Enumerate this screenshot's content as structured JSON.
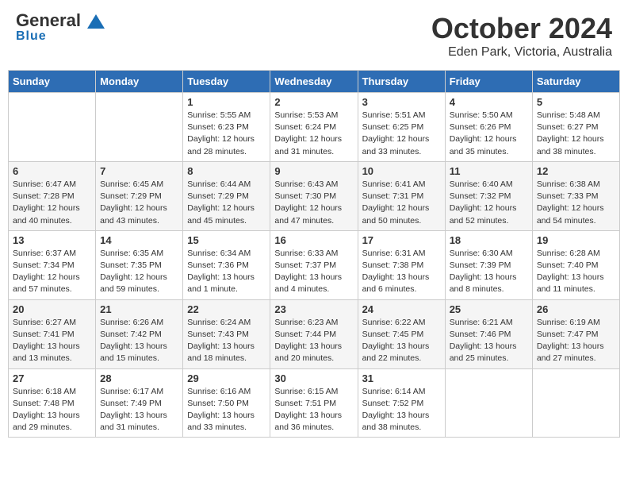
{
  "header": {
    "logo_general": "General",
    "logo_blue": "Blue",
    "month_title": "October 2024",
    "location": "Eden Park, Victoria, Australia"
  },
  "days_of_week": [
    "Sunday",
    "Monday",
    "Tuesday",
    "Wednesday",
    "Thursday",
    "Friday",
    "Saturday"
  ],
  "weeks": [
    [
      {
        "day": "",
        "info": ""
      },
      {
        "day": "",
        "info": ""
      },
      {
        "day": "1",
        "info": "Sunrise: 5:55 AM\nSunset: 6:23 PM\nDaylight: 12 hours\nand 28 minutes."
      },
      {
        "day": "2",
        "info": "Sunrise: 5:53 AM\nSunset: 6:24 PM\nDaylight: 12 hours\nand 31 minutes."
      },
      {
        "day": "3",
        "info": "Sunrise: 5:51 AM\nSunset: 6:25 PM\nDaylight: 12 hours\nand 33 minutes."
      },
      {
        "day": "4",
        "info": "Sunrise: 5:50 AM\nSunset: 6:26 PM\nDaylight: 12 hours\nand 35 minutes."
      },
      {
        "day": "5",
        "info": "Sunrise: 5:48 AM\nSunset: 6:27 PM\nDaylight: 12 hours\nand 38 minutes."
      }
    ],
    [
      {
        "day": "6",
        "info": "Sunrise: 6:47 AM\nSunset: 7:28 PM\nDaylight: 12 hours\nand 40 minutes."
      },
      {
        "day": "7",
        "info": "Sunrise: 6:45 AM\nSunset: 7:29 PM\nDaylight: 12 hours\nand 43 minutes."
      },
      {
        "day": "8",
        "info": "Sunrise: 6:44 AM\nSunset: 7:29 PM\nDaylight: 12 hours\nand 45 minutes."
      },
      {
        "day": "9",
        "info": "Sunrise: 6:43 AM\nSunset: 7:30 PM\nDaylight: 12 hours\nand 47 minutes."
      },
      {
        "day": "10",
        "info": "Sunrise: 6:41 AM\nSunset: 7:31 PM\nDaylight: 12 hours\nand 50 minutes."
      },
      {
        "day": "11",
        "info": "Sunrise: 6:40 AM\nSunset: 7:32 PM\nDaylight: 12 hours\nand 52 minutes."
      },
      {
        "day": "12",
        "info": "Sunrise: 6:38 AM\nSunset: 7:33 PM\nDaylight: 12 hours\nand 54 minutes."
      }
    ],
    [
      {
        "day": "13",
        "info": "Sunrise: 6:37 AM\nSunset: 7:34 PM\nDaylight: 12 hours\nand 57 minutes."
      },
      {
        "day": "14",
        "info": "Sunrise: 6:35 AM\nSunset: 7:35 PM\nDaylight: 12 hours\nand 59 minutes."
      },
      {
        "day": "15",
        "info": "Sunrise: 6:34 AM\nSunset: 7:36 PM\nDaylight: 13 hours\nand 1 minute."
      },
      {
        "day": "16",
        "info": "Sunrise: 6:33 AM\nSunset: 7:37 PM\nDaylight: 13 hours\nand 4 minutes."
      },
      {
        "day": "17",
        "info": "Sunrise: 6:31 AM\nSunset: 7:38 PM\nDaylight: 13 hours\nand 6 minutes."
      },
      {
        "day": "18",
        "info": "Sunrise: 6:30 AM\nSunset: 7:39 PM\nDaylight: 13 hours\nand 8 minutes."
      },
      {
        "day": "19",
        "info": "Sunrise: 6:28 AM\nSunset: 7:40 PM\nDaylight: 13 hours\nand 11 minutes."
      }
    ],
    [
      {
        "day": "20",
        "info": "Sunrise: 6:27 AM\nSunset: 7:41 PM\nDaylight: 13 hours\nand 13 minutes."
      },
      {
        "day": "21",
        "info": "Sunrise: 6:26 AM\nSunset: 7:42 PM\nDaylight: 13 hours\nand 15 minutes."
      },
      {
        "day": "22",
        "info": "Sunrise: 6:24 AM\nSunset: 7:43 PM\nDaylight: 13 hours\nand 18 minutes."
      },
      {
        "day": "23",
        "info": "Sunrise: 6:23 AM\nSunset: 7:44 PM\nDaylight: 13 hours\nand 20 minutes."
      },
      {
        "day": "24",
        "info": "Sunrise: 6:22 AM\nSunset: 7:45 PM\nDaylight: 13 hours\nand 22 minutes."
      },
      {
        "day": "25",
        "info": "Sunrise: 6:21 AM\nSunset: 7:46 PM\nDaylight: 13 hours\nand 25 minutes."
      },
      {
        "day": "26",
        "info": "Sunrise: 6:19 AM\nSunset: 7:47 PM\nDaylight: 13 hours\nand 27 minutes."
      }
    ],
    [
      {
        "day": "27",
        "info": "Sunrise: 6:18 AM\nSunset: 7:48 PM\nDaylight: 13 hours\nand 29 minutes."
      },
      {
        "day": "28",
        "info": "Sunrise: 6:17 AM\nSunset: 7:49 PM\nDaylight: 13 hours\nand 31 minutes."
      },
      {
        "day": "29",
        "info": "Sunrise: 6:16 AM\nSunset: 7:50 PM\nDaylight: 13 hours\nand 33 minutes."
      },
      {
        "day": "30",
        "info": "Sunrise: 6:15 AM\nSunset: 7:51 PM\nDaylight: 13 hours\nand 36 minutes."
      },
      {
        "day": "31",
        "info": "Sunrise: 6:14 AM\nSunset: 7:52 PM\nDaylight: 13 hours\nand 38 minutes."
      },
      {
        "day": "",
        "info": ""
      },
      {
        "day": "",
        "info": ""
      }
    ]
  ]
}
